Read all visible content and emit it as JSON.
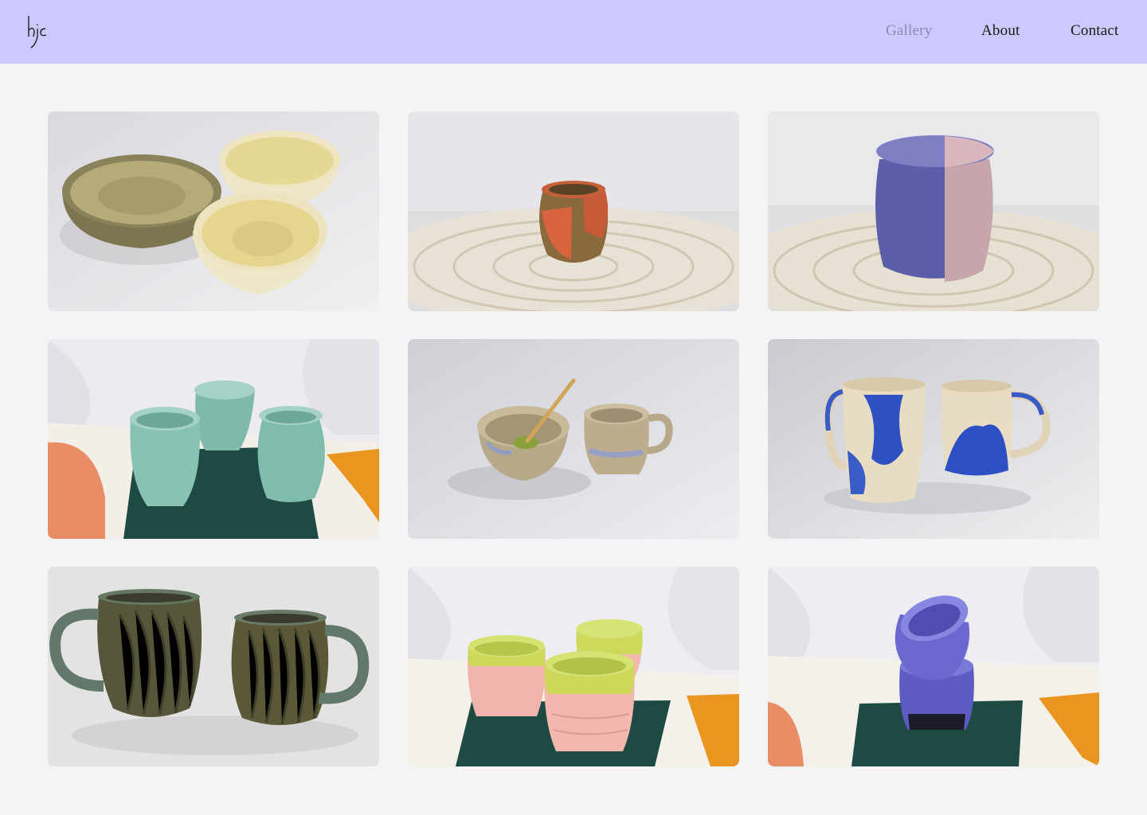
{
  "brand": {
    "logo_text": "hjc"
  },
  "nav": {
    "items": [
      {
        "label": "Gallery",
        "active": true
      },
      {
        "label": "About",
        "active": false
      },
      {
        "label": "Contact",
        "active": false
      }
    ]
  },
  "gallery": {
    "items": [
      {
        "subject": "three glazed bowls, olive and cream"
      },
      {
        "subject": "small speckled vase with orange glaze on woven mat"
      },
      {
        "subject": "lidded jar in blue and pink glaze on woven mat"
      },
      {
        "subject": "three mint green cups on striped towel"
      },
      {
        "subject": "matcha bowl with bamboo spoon and small mug"
      },
      {
        "subject": "two mugs with blue splash glaze"
      },
      {
        "subject": "two carved green mugs"
      },
      {
        "subject": "three pink and lime green cups on striped towel"
      },
      {
        "subject": "two stacked purple cups on striped towel"
      }
    ]
  },
  "colors": {
    "header_bg": "#cbc9fd",
    "page_bg": "#f4f4f4",
    "nav_active": "#8c8bb0",
    "nav_text": "#1a1a1a"
  }
}
